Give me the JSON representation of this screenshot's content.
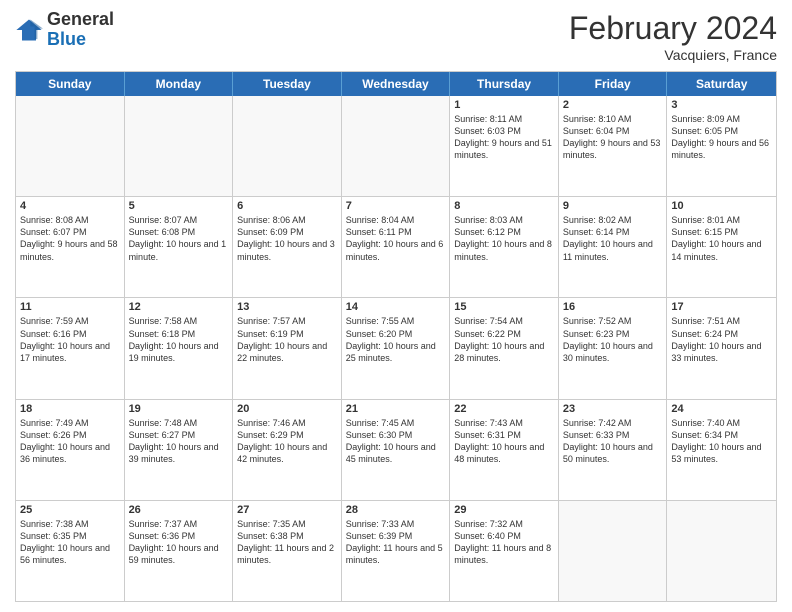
{
  "header": {
    "logo": {
      "line1": "General",
      "line2": "Blue"
    },
    "title": "February 2024",
    "subtitle": "Vacquiers, France"
  },
  "weekdays": [
    "Sunday",
    "Monday",
    "Tuesday",
    "Wednesday",
    "Thursday",
    "Friday",
    "Saturday"
  ],
  "weeks": [
    [
      {
        "day": "",
        "empty": true
      },
      {
        "day": "",
        "empty": true
      },
      {
        "day": "",
        "empty": true
      },
      {
        "day": "",
        "empty": true
      },
      {
        "day": "1",
        "sunrise": "8:11 AM",
        "sunset": "6:03 PM",
        "daylight": "9 hours and 51 minutes."
      },
      {
        "day": "2",
        "sunrise": "8:10 AM",
        "sunset": "6:04 PM",
        "daylight": "9 hours and 53 minutes."
      },
      {
        "day": "3",
        "sunrise": "8:09 AM",
        "sunset": "6:05 PM",
        "daylight": "9 hours and 56 minutes."
      }
    ],
    [
      {
        "day": "4",
        "sunrise": "8:08 AM",
        "sunset": "6:07 PM",
        "daylight": "9 hours and 58 minutes."
      },
      {
        "day": "5",
        "sunrise": "8:07 AM",
        "sunset": "6:08 PM",
        "daylight": "10 hours and 1 minute."
      },
      {
        "day": "6",
        "sunrise": "8:06 AM",
        "sunset": "6:09 PM",
        "daylight": "10 hours and 3 minutes."
      },
      {
        "day": "7",
        "sunrise": "8:04 AM",
        "sunset": "6:11 PM",
        "daylight": "10 hours and 6 minutes."
      },
      {
        "day": "8",
        "sunrise": "8:03 AM",
        "sunset": "6:12 PM",
        "daylight": "10 hours and 8 minutes."
      },
      {
        "day": "9",
        "sunrise": "8:02 AM",
        "sunset": "6:14 PM",
        "daylight": "10 hours and 11 minutes."
      },
      {
        "day": "10",
        "sunrise": "8:01 AM",
        "sunset": "6:15 PM",
        "daylight": "10 hours and 14 minutes."
      }
    ],
    [
      {
        "day": "11",
        "sunrise": "7:59 AM",
        "sunset": "6:16 PM",
        "daylight": "10 hours and 17 minutes."
      },
      {
        "day": "12",
        "sunrise": "7:58 AM",
        "sunset": "6:18 PM",
        "daylight": "10 hours and 19 minutes."
      },
      {
        "day": "13",
        "sunrise": "7:57 AM",
        "sunset": "6:19 PM",
        "daylight": "10 hours and 22 minutes."
      },
      {
        "day": "14",
        "sunrise": "7:55 AM",
        "sunset": "6:20 PM",
        "daylight": "10 hours and 25 minutes."
      },
      {
        "day": "15",
        "sunrise": "7:54 AM",
        "sunset": "6:22 PM",
        "daylight": "10 hours and 28 minutes."
      },
      {
        "day": "16",
        "sunrise": "7:52 AM",
        "sunset": "6:23 PM",
        "daylight": "10 hours and 30 minutes."
      },
      {
        "day": "17",
        "sunrise": "7:51 AM",
        "sunset": "6:24 PM",
        "daylight": "10 hours and 33 minutes."
      }
    ],
    [
      {
        "day": "18",
        "sunrise": "7:49 AM",
        "sunset": "6:26 PM",
        "daylight": "10 hours and 36 minutes."
      },
      {
        "day": "19",
        "sunrise": "7:48 AM",
        "sunset": "6:27 PM",
        "daylight": "10 hours and 39 minutes."
      },
      {
        "day": "20",
        "sunrise": "7:46 AM",
        "sunset": "6:29 PM",
        "daylight": "10 hours and 42 minutes."
      },
      {
        "day": "21",
        "sunrise": "7:45 AM",
        "sunset": "6:30 PM",
        "daylight": "10 hours and 45 minutes."
      },
      {
        "day": "22",
        "sunrise": "7:43 AM",
        "sunset": "6:31 PM",
        "daylight": "10 hours and 48 minutes."
      },
      {
        "day": "23",
        "sunrise": "7:42 AM",
        "sunset": "6:33 PM",
        "daylight": "10 hours and 50 minutes."
      },
      {
        "day": "24",
        "sunrise": "7:40 AM",
        "sunset": "6:34 PM",
        "daylight": "10 hours and 53 minutes."
      }
    ],
    [
      {
        "day": "25",
        "sunrise": "7:38 AM",
        "sunset": "6:35 PM",
        "daylight": "10 hours and 56 minutes."
      },
      {
        "day": "26",
        "sunrise": "7:37 AM",
        "sunset": "6:36 PM",
        "daylight": "10 hours and 59 minutes."
      },
      {
        "day": "27",
        "sunrise": "7:35 AM",
        "sunset": "6:38 PM",
        "daylight": "11 hours and 2 minutes."
      },
      {
        "day": "28",
        "sunrise": "7:33 AM",
        "sunset": "6:39 PM",
        "daylight": "11 hours and 5 minutes."
      },
      {
        "day": "29",
        "sunrise": "7:32 AM",
        "sunset": "6:40 PM",
        "daylight": "11 hours and 8 minutes."
      },
      {
        "day": "",
        "empty": true
      },
      {
        "day": "",
        "empty": true
      }
    ]
  ]
}
